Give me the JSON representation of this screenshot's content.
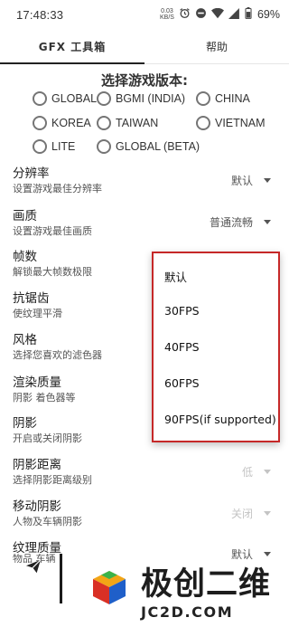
{
  "status_bar": {
    "time": "17:48:33",
    "net_speed_value": "0.03",
    "net_speed_unit": "KB/S",
    "battery": "69%"
  },
  "tabs": [
    {
      "label": "GFX 工具箱"
    },
    {
      "label": "帮助"
    }
  ],
  "version_title": "选择游戏版本:",
  "versions": [
    {
      "label": "GLOBAL"
    },
    {
      "label": "BGMI (INDIA)"
    },
    {
      "label": "CHINA"
    },
    {
      "label": "KOREA"
    },
    {
      "label": "TAIWAN"
    },
    {
      "label": "VIETNAM"
    },
    {
      "label": "LITE"
    },
    {
      "label": "GLOBAL (BETA)"
    }
  ],
  "settings": [
    {
      "title": "分辨率",
      "subtitle": "设置游戏最佳分辨率",
      "value": "默认"
    },
    {
      "title": "画质",
      "subtitle": "设置游戏最佳画质",
      "value": "普通流畅"
    },
    {
      "title": "帧数",
      "subtitle": "解锁最大帧数极限"
    },
    {
      "title": "抗锯齿",
      "subtitle": "使纹理平滑"
    },
    {
      "title": "风格",
      "subtitle": "选择您喜欢的滤色器"
    },
    {
      "title": "渲染质量",
      "subtitle": "阴影 着色器等"
    },
    {
      "title": "阴影",
      "subtitle": "开启或关闭阴影"
    },
    {
      "title": "阴影距离",
      "subtitle": "选择阴影距离级别",
      "value": "低"
    },
    {
      "title": "移动阴影",
      "subtitle": "人物及车辆阴影",
      "value": "关闭"
    },
    {
      "title": "纹理质量",
      "subtitle": "物品 车辆等",
      "value": "默认"
    }
  ],
  "fps_dropdown": {
    "options": [
      "默认",
      "30FPS",
      "40FPS",
      "60FPS",
      "90FPS(if supported)"
    ]
  },
  "watermark": {
    "text": "极创二维",
    "url": "JC2D.COM"
  },
  "colors": {
    "dropdown_border": "#c62828",
    "radio_border": "#757575",
    "tab_indicator": "#222222",
    "disabled_text": "#c4c4c4"
  }
}
